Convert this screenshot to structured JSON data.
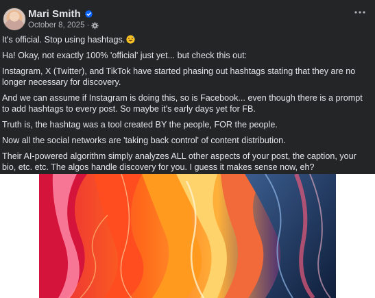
{
  "post": {
    "author": {
      "name": "Mari Smith",
      "verified": true,
      "avatar": "avatar-photo"
    },
    "timestamp": "October 8, 2025",
    "separator": "·",
    "privacy_icon": "settings-gear-icon",
    "more_icon": "more-horizontal-icon",
    "paragraphs": [
      "It's official. Stop using hashtags.",
      "Ha! Okay, not exactly 100% 'official' just yet... but check this out:",
      "Instagram, X (Twitter), and TikTok have started phasing out hashtags stating that they are no longer necessary for discovery.",
      "And we can assume if Instagram is doing this, so is Facebook... even though there is a prompt to add hashtags to every post. So maybe it's early days yet for FB.",
      "Truth is, the hashtag was a tool created BY the people, FOR the people.",
      "Now all the social networks are 'taking back control' of content distribution.",
      "Their AI-powered algorithm simply analyzes ALL other aspects of your post, the caption, your bio, etc. etc. The algos handle discovery for you. I guess it makes sense now, eh?"
    ],
    "first_paragraph_emoji": "grinning-sweat-emoji-icon",
    "image": "abstract-fluid-art-image"
  },
  "colors": {
    "card_background": "#242526",
    "text_primary": "#e4e6eb",
    "text_secondary": "#b0b3b8",
    "verified_badge": "#0866ff"
  }
}
